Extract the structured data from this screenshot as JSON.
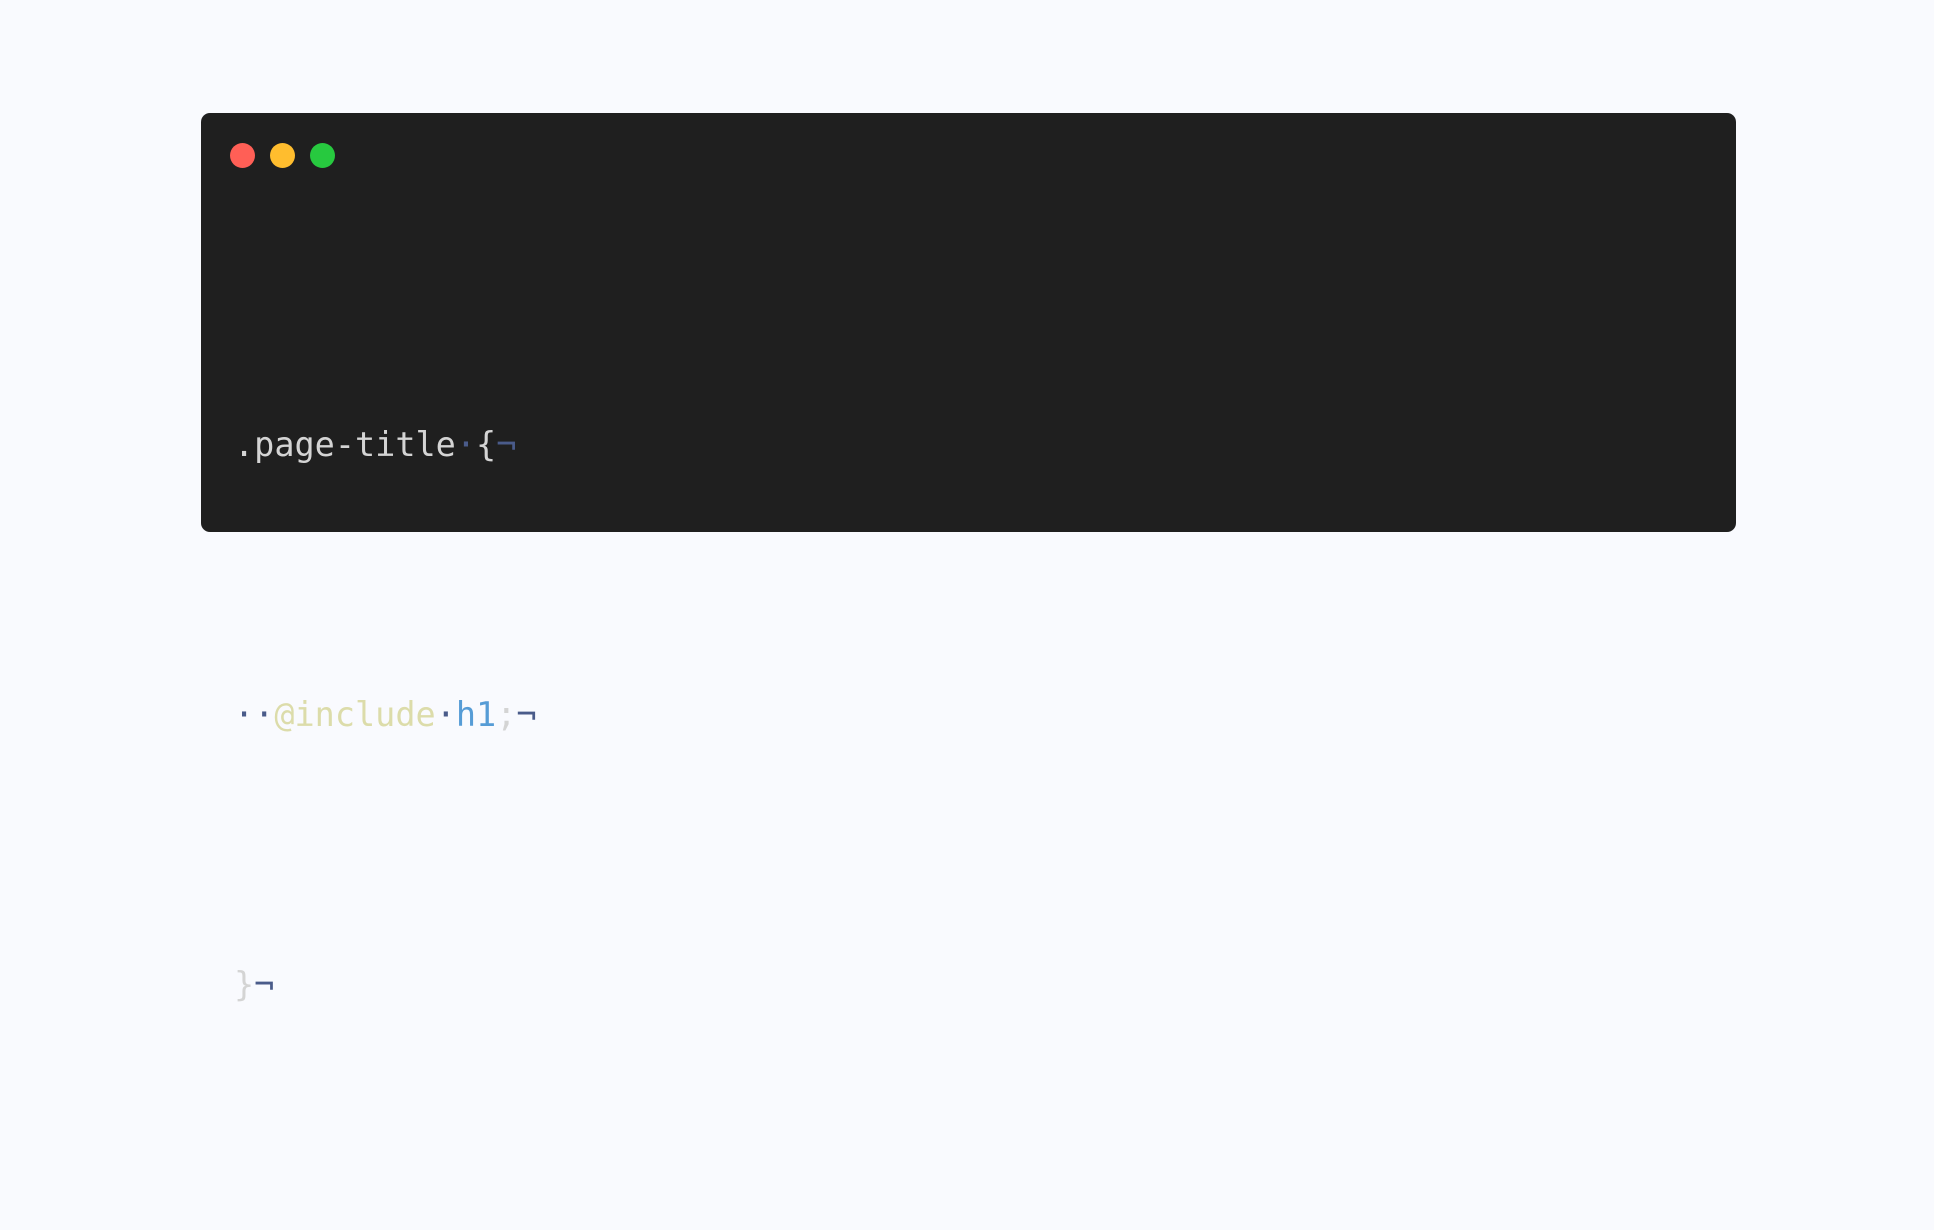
{
  "window": {
    "controls": [
      "close",
      "minimize",
      "maximize"
    ],
    "colors": {
      "background": "#1f1f1f",
      "close": "#ff5f56",
      "minimize": "#ffbd2e",
      "maximize": "#27c93f"
    }
  },
  "code": {
    "line1": {
      "selector": ".page-title",
      "space": "·",
      "brace": "{",
      "eol": "¬"
    },
    "line2": {
      "indent": "··",
      "directive": "@include",
      "space": "·",
      "value": "h1",
      "semicolon": ";",
      "eol": "¬"
    },
    "line3": {
      "brace": "}",
      "eol": "¬"
    },
    "colors": {
      "text": "#d4d4d4",
      "invisible": "#4a5b8a",
      "directive": "#dcdcaa",
      "value": "#569cd6"
    }
  }
}
